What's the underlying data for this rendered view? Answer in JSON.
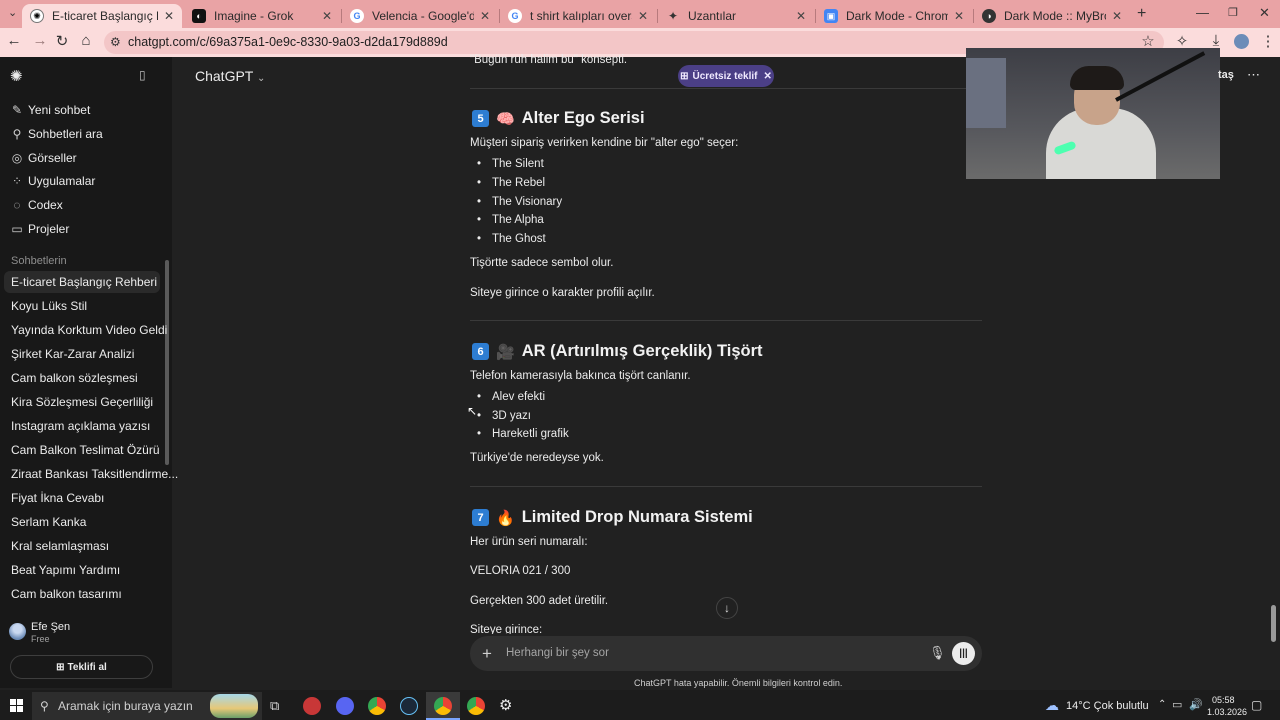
{
  "browser": {
    "tabs": [
      {
        "title": "E-ticaret Başlangıç Rehberi",
        "active": true
      },
      {
        "title": "Imagine - Grok",
        "active": false
      },
      {
        "title": "Velencia - Google'da Ara",
        "active": false
      },
      {
        "title": "t shirt kalıpları oversize - Goog",
        "active": false
      },
      {
        "title": "Uzantılar",
        "active": false
      },
      {
        "title": "Dark Mode - Chrome Web Mag",
        "active": false
      },
      {
        "title": "Dark Mode :: MyBrowserAddon",
        "active": false
      }
    ],
    "url": "chatgpt.com/c/69a375a1-0e9c-8330-9a03-d2da179d889d"
  },
  "sidebar": {
    "top_items": [
      {
        "icon": "edit-icon",
        "label": "Yeni sohbet"
      },
      {
        "icon": "search-icon",
        "label": "Sohbetleri ara"
      },
      {
        "icon": "images-icon",
        "label": "Görseller"
      },
      {
        "icon": "apps-icon",
        "label": "Uygulamalar"
      },
      {
        "icon": "codex-icon",
        "label": "Codex"
      },
      {
        "icon": "folder-icon",
        "label": "Projeler"
      }
    ],
    "section_title": "Sohbetlerin",
    "chats": [
      "E-ticaret Başlangıç Rehberi",
      "Koyu Lüks Stil",
      "Yayında Korktum Video Geldi",
      "Şirket Kar-Zarar Analizi",
      "Cam balkon sözleşmesi",
      "Kira Sözleşmesi Geçerliliği",
      "Instagram açıklama yazısı",
      "Cam Balkon Teslimat Özürü",
      "Ziraat Bankası Taksitlendirme...",
      "Fiyat İkna Cevabı",
      "Serlam Kanka",
      "Kral selamlaşması",
      "Beat Yapımı Yardımı",
      "Cam balkon tasarımı"
    ],
    "user": {
      "name": "Efe Şen",
      "plan": "Free"
    },
    "upgrade_label": "Teklifi al"
  },
  "header": {
    "model": "ChatGPT",
    "offer_badge": "Ücretsiz teklif",
    "share_partial": "taş"
  },
  "content": {
    "top_cut": "\"Bugün ruh halim bu\" konsepti.",
    "sec5": {
      "num": "5",
      "emoji": "🧠",
      "title": "Alter Ego Serisi",
      "intro": "Müşteri sipariş verirken kendine bir \"alter ego\" seçer:",
      "items": [
        "The Silent",
        "The Rebel",
        "The Visionary",
        "The Alpha",
        "The Ghost"
      ],
      "p1": "Tişörtte sadece sembol olur.",
      "p2": "Siteye girince o karakter profili açılır."
    },
    "sec6": {
      "num": "6",
      "emoji": "🎥",
      "title": "AR (Artırılmış Gerçeklik) Tişört",
      "intro": "Telefon kamerasıyla bakınca tişört canlanır.",
      "items": [
        "Alev efekti",
        "3D yazı",
        "Hareketli grafik"
      ],
      "p1": "Türkiye'de neredeyse yok."
    },
    "sec7": {
      "num": "7",
      "emoji": "🔥",
      "title": "Limited Drop Numara Sistemi",
      "intro": "Her ürün seri numaralı:",
      "p1": "VELORIA 021 / 300",
      "p2": "Gerçekten 300 adet üretilir.",
      "p3": "Siteye girince:"
    }
  },
  "composer": {
    "placeholder": "Herhangi bir şey sor",
    "disclaimer": "ChatGPT hata yapabilir. Önemli bilgileri kontrol edin."
  },
  "taskbar": {
    "search_placeholder": "Aramak için buraya yazın",
    "weather": "14°C  Çok bulutlu",
    "time": "05:58",
    "date": "1.03.2026"
  },
  "colors": {
    "tab_strip": "#e9a3a5",
    "toolbar": "#fbdcdc",
    "sidebar_bg": "#181818",
    "main_bg": "#212121",
    "offer_badge": "#4b3f86",
    "number_badge": "#2d7dd2"
  }
}
